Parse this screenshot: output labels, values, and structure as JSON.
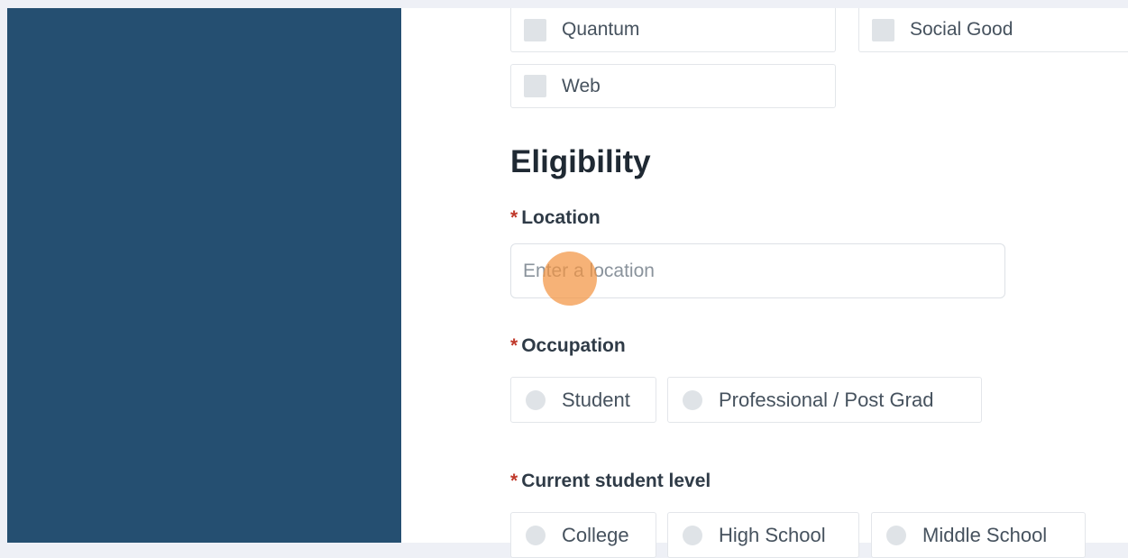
{
  "interests": [
    {
      "label": "Quantum"
    },
    {
      "label": "Social Good"
    },
    {
      "label": "Web"
    }
  ],
  "eligibility": {
    "heading": "Eligibility",
    "required_marker": "*",
    "location": {
      "label": "Location",
      "placeholder": "Enter a location",
      "value": ""
    },
    "occupation": {
      "label": "Occupation",
      "options": [
        "Student",
        "Professional / Post Grad"
      ]
    },
    "student_level": {
      "label": "Current student level",
      "options": [
        "College",
        "High School",
        "Middle School"
      ]
    }
  },
  "colors": {
    "sidebar": "#254f71",
    "required": "#c0392b",
    "cursor_highlight": "#f39442"
  }
}
